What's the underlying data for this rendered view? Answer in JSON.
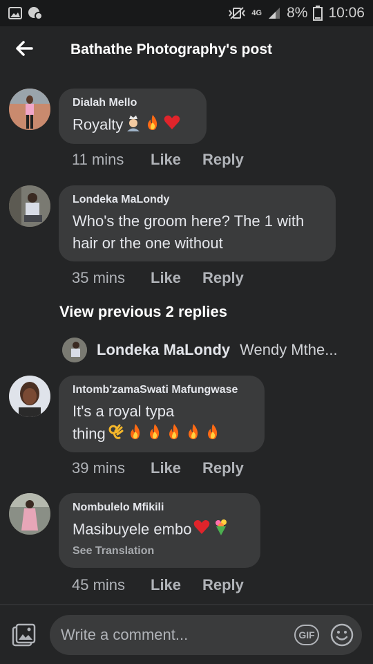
{
  "status_bar": {
    "network": "4G",
    "battery": "8%",
    "time": "10:06"
  },
  "header": {
    "title": "Bathathe Photography's post"
  },
  "comments": [
    {
      "author": "Dialah Mello",
      "text": "Royalty",
      "emojis": [
        "person-with-crown-emoji",
        "fire-emoji",
        "red-heart-emoji"
      ],
      "time": "11 mins",
      "like": "Like",
      "reply": "Reply"
    },
    {
      "author": "Londeka MaLondy",
      "text": "Who's the groom here? The 1 with hair or the one without",
      "time": "35 mins",
      "like": "Like",
      "reply": "Reply"
    },
    {
      "author": "Intomb'zamaSwati Mafungwase",
      "text_line1": "It's a royal typa",
      "text_line2": "thing",
      "emojis": [
        "ok-hand-emoji",
        "fire-emoji",
        "fire-emoji",
        "fire-emoji",
        "fire-emoji",
        "fire-emoji"
      ],
      "time": "39 mins",
      "like": "Like",
      "reply": "Reply"
    },
    {
      "author": "Nombulelo Mfikili",
      "text": "Masibuyele embo",
      "emojis": [
        "red-heart-emoji",
        "bouquet-emoji"
      ],
      "see_translation": "See Translation",
      "time": "45 mins",
      "like": "Like",
      "reply": "Reply"
    }
  ],
  "replies": {
    "view_previous": "View previous 2 replies",
    "preview_author": "Londeka MaLondy",
    "preview_text": "Wendy Mthe..."
  },
  "composer": {
    "placeholder": "Write a comment...",
    "gif_label": "GIF"
  },
  "colors": {
    "background": "#242526",
    "bubble": "#3a3b3c",
    "text": "#e4e6eb",
    "muted": "#b0b3b8"
  }
}
